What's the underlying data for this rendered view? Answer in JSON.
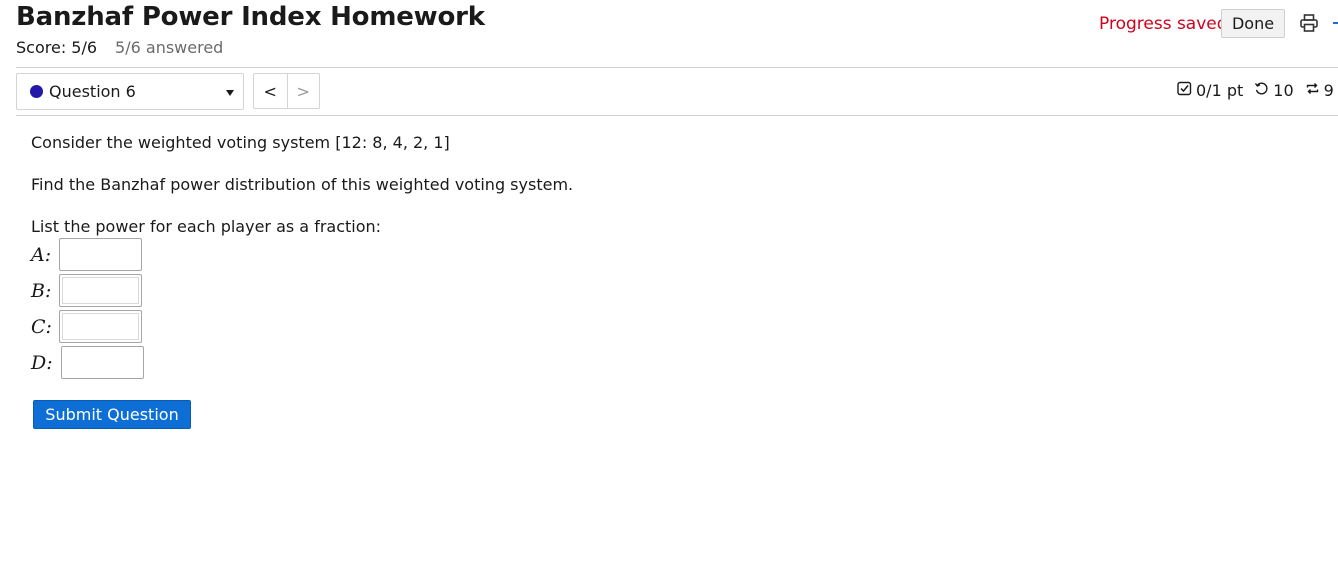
{
  "header": {
    "title": "Banzhaf Power Index Homework",
    "score": "Score: 5/6",
    "answered": "5/6 answered",
    "progress_status": "Progress saved",
    "done_label": "Done",
    "status_color": "#d0021b"
  },
  "question_nav": {
    "selected": "Question 6",
    "prev_symbol": "<",
    "next_symbol": ">",
    "points": "0/1 pt",
    "retries": "10",
    "attempts": "9"
  },
  "question": {
    "system": "Consider the weighted voting system [12: 8, 4, 2, 1]",
    "instruction": "Find the Banzhaf power distribution of this weighted voting system.",
    "list_prompt": "List the power for each player as a fraction:",
    "players": [
      {
        "label": "A:",
        "value": ""
      },
      {
        "label": "B:",
        "value": ""
      },
      {
        "label": "C:",
        "value": ""
      },
      {
        "label": "D:",
        "value": ""
      }
    ],
    "submit_label": "Submit Question"
  },
  "icons": {
    "print": "printer-icon",
    "points": "checkbox-icon",
    "retry": "retry-icon",
    "attempts": "repeat-icon",
    "question_status": "dot-icon"
  },
  "colors": {
    "accent": "#0d6fd6",
    "dot": "#2418a8"
  }
}
